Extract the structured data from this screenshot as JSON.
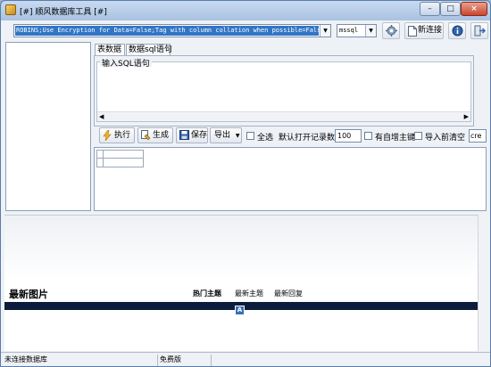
{
  "window": {
    "title": "[#] 顺风数据库工具 [#]",
    "controls": {
      "minimize": "–",
      "maximize": "□",
      "close": "×"
    }
  },
  "toolbar": {
    "connection_string": "ROBINS;Use Encryption for Data=False;Tag with column collation when possible=False",
    "db_type": "mssql",
    "new_connection_label": "新连接"
  },
  "tabs": [
    {
      "label": "表数据"
    },
    {
      "label": "数据sql语句"
    }
  ],
  "sql_group": {
    "legend": "输入SQL语句",
    "value": ""
  },
  "actions": {
    "execute_label": "执行",
    "generate_label": "生成",
    "save_label": "保存",
    "export_label": "导出",
    "select_all_label": "全选",
    "default_records_label": "默认打开记录数:",
    "default_records_value": "100",
    "auto_increment_label": "有自增主键",
    "clear_before_import_label": "导入前清空",
    "extra_field_value": "cre"
  },
  "web": {
    "section_title": "最新图片",
    "links": [
      {
        "label": "热门主题",
        "bold": true
      },
      {
        "label": "最新主题",
        "bold": false
      },
      {
        "label": "最新回复",
        "bold": false
      }
    ],
    "badge_letter": "A"
  },
  "status": {
    "connection": "未连接数据库",
    "middle": "",
    "edition": "免费版"
  },
  "icons": {
    "app": "database-app-icon",
    "gear": "gear-icon",
    "new_connection": "new-document-icon",
    "info": "info-icon",
    "exit": "exit-icon",
    "execute": "lightning-icon",
    "generate": "generate-icon",
    "save": "floppy-disk-icon",
    "export_dropdown": "chevron-down-icon"
  }
}
